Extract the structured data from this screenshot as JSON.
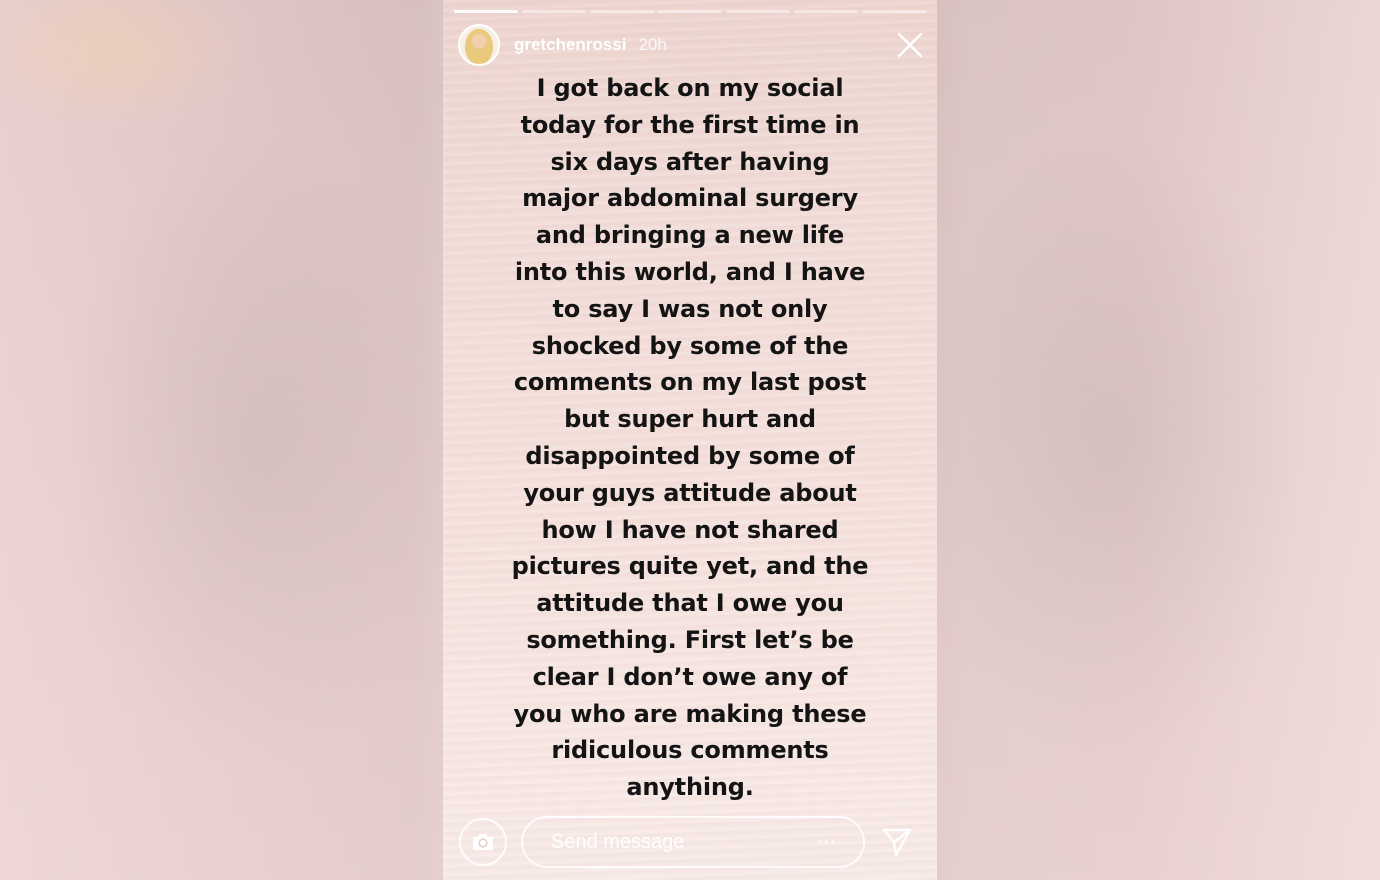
{
  "story": {
    "progress": {
      "segments": 7,
      "current": 1
    },
    "header": {
      "username": "gretchenrossi",
      "time": "20h"
    },
    "text_lines": [
      "I got back on my social",
      "today for the first time in",
      "six days after having",
      "major abdominal surgery",
      "and bringing a new life",
      "into this world, and I have",
      "to say I was not only",
      "shocked by some of the",
      "comments on my last post",
      "but super hurt and",
      "disappointed by some of",
      "your guys attitude about",
      "how I have not shared",
      "pictures quite yet, and the",
      "attitude that I owe you",
      "something. First let’s be",
      "clear I don’t owe any of",
      "you who are making these",
      "ridiculous comments",
      "anything."
    ],
    "bottom_bar": {
      "message_placeholder": "Send message",
      "more_label": "···"
    },
    "icons": [
      "close-icon",
      "camera-icon",
      "send-icon",
      "more-icon"
    ]
  }
}
